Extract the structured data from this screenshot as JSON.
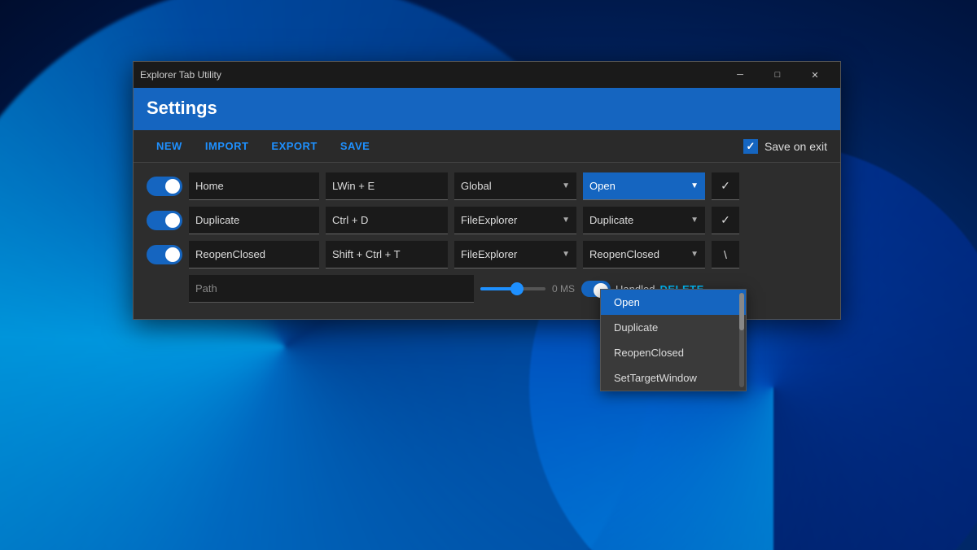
{
  "window": {
    "title": "Explorer Tab Utility",
    "minimize_label": "─",
    "maximize_label": "□",
    "close_label": "✕"
  },
  "header": {
    "title": "Settings"
  },
  "toolbar": {
    "new_label": "NEW",
    "import_label": "IMPORT",
    "export_label": "EXPORT",
    "save_label": "SAVE",
    "save_on_exit_label": "Save on exit"
  },
  "rows": [
    {
      "enabled": true,
      "name": "Home",
      "hotkey": "LWin + E",
      "scope": "Global",
      "action": "Open",
      "action_btn": "✓"
    },
    {
      "enabled": true,
      "name": "Duplicate",
      "hotkey": "Ctrl + D",
      "scope": "FileExplorer",
      "action": "Duplicate",
      "action_btn": "✓"
    },
    {
      "enabled": true,
      "name": "ReopenClosed",
      "hotkey": "Shift + Ctrl + T",
      "scope": "FileExplorer",
      "action": "ReopenClosed",
      "action_btn": "\\"
    }
  ],
  "path_row": {
    "placeholder": "Path",
    "delay_label": "0 MS",
    "handled_label": "Handled",
    "delete_label": "DELETE"
  },
  "dropdown": {
    "items": [
      {
        "label": "Open",
        "selected": true
      },
      {
        "label": "Duplicate",
        "selected": false
      },
      {
        "label": "ReopenClosed",
        "selected": false
      },
      {
        "label": "SetTargetWindow",
        "selected": false
      }
    ]
  }
}
